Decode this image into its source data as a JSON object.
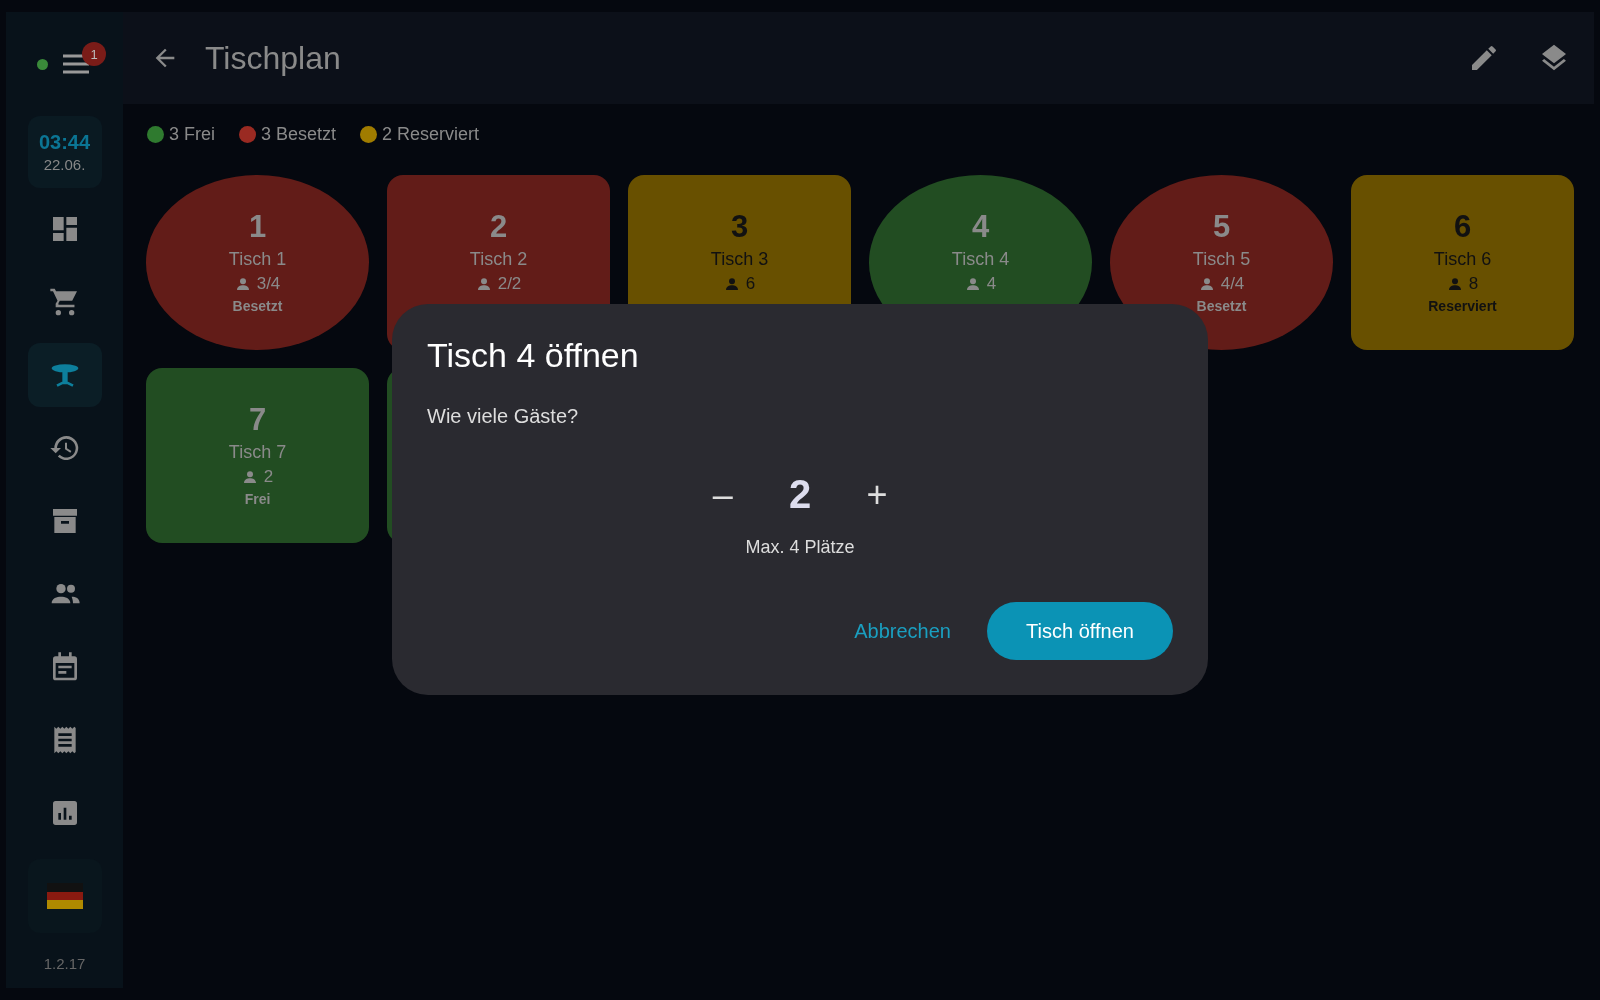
{
  "sidebar": {
    "connection": {
      "color": "#3a8a3a"
    },
    "menu_badge": "1",
    "clock": {
      "time": "03:44",
      "date": "22.06."
    },
    "nav": [
      {
        "selected": false
      },
      {
        "selected": false
      },
      {
        "selected": true
      },
      {
        "selected": false
      },
      {
        "selected": false
      },
      {
        "selected": false
      },
      {
        "selected": false
      },
      {
        "selected": false
      },
      {
        "selected": false
      }
    ],
    "version": "1.2.17"
  },
  "header": {
    "title": "Tischplan"
  },
  "legend": [
    {
      "label": "3 Frei",
      "color": "#2f7a2f"
    },
    {
      "label": "3 Besetzt",
      "color": "#9a2a22"
    },
    {
      "label": "2 Reserviert",
      "color": "#a07c00"
    }
  ],
  "tables": [
    {
      "kind": "round",
      "color": "#621c18",
      "number": "1",
      "name": "Tisch 1",
      "guests": "3/4",
      "status": "Besetzt"
    },
    {
      "kind": "square",
      "color": "#621c18",
      "number": "2",
      "name": "Tisch 2",
      "guests": "2/2"
    },
    {
      "kind": "square",
      "color": "#685000",
      "number": "3",
      "name": "Tisch 3",
      "guests": "6"
    },
    {
      "kind": "round",
      "color": "#224d22",
      "number": "4",
      "name": "Tisch 4",
      "guests": "4"
    },
    {
      "kind": "round",
      "color": "#621c18",
      "number": "5",
      "name": "Tisch 5",
      "guests": "4/4",
      "status": "Besetzt"
    },
    {
      "kind": "square",
      "color": "#685000",
      "number": "6",
      "name": "Tisch 6",
      "guests": "8",
      "status": "Reserviert"
    },
    {
      "kind": "square",
      "color": "#224d22",
      "number": "7",
      "name": "Tisch 7",
      "guests": "2",
      "status": "Frei"
    },
    {
      "kind": "square",
      "color": "#224d22"
    }
  ],
  "dialog": {
    "title": "Tisch 4 öffnen",
    "question": "Wie viele Gäste?",
    "decrement": "–",
    "count": "2",
    "increment": "+",
    "hint": "Max. 4 Plätze",
    "cancel": "Abbrechen",
    "confirm": "Tisch öffnen"
  }
}
